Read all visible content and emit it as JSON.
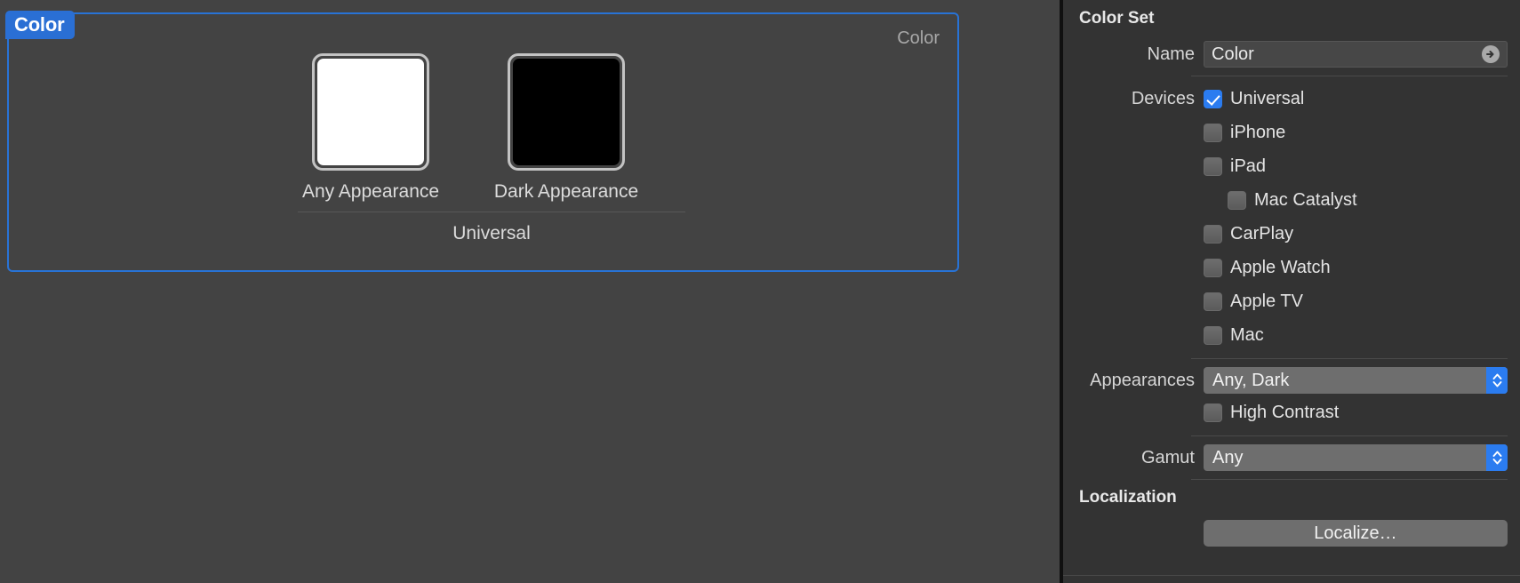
{
  "canvas": {
    "selection_tab_label": "Color",
    "corner_label": "Color",
    "group_label": "Universal",
    "swatches": [
      {
        "label": "Any Appearance",
        "color": "#ffffff"
      },
      {
        "label": "Dark Appearance",
        "color": "#000000"
      }
    ]
  },
  "inspector": {
    "color_set": {
      "title": "Color Set",
      "name_label": "Name",
      "name_value": "Color",
      "name_arrow_icon": "circle-arrow-right-icon",
      "devices_label": "Devices",
      "devices": [
        {
          "label": "Universal",
          "checked": true,
          "indent": 0
        },
        {
          "label": "iPhone",
          "checked": false,
          "indent": 0
        },
        {
          "label": "iPad",
          "checked": false,
          "indent": 0
        },
        {
          "label": "Mac Catalyst",
          "checked": false,
          "indent": 1
        },
        {
          "label": "CarPlay",
          "checked": false,
          "indent": 0
        },
        {
          "label": "Apple Watch",
          "checked": false,
          "indent": 0
        },
        {
          "label": "Apple TV",
          "checked": false,
          "indent": 0
        },
        {
          "label": "Mac",
          "checked": false,
          "indent": 0
        }
      ],
      "appearances_label": "Appearances",
      "appearances_value": "Any, Dark",
      "high_contrast_label": "High Contrast",
      "high_contrast_checked": false,
      "gamut_label": "Gamut",
      "gamut_value": "Any"
    },
    "localization": {
      "title": "Localization",
      "localize_button": "Localize…"
    }
  },
  "colors": {
    "accent_blue": "#2b7cf0",
    "selection_border": "#2873d6",
    "canvas_bg": "#434343",
    "inspector_bg": "#333333"
  }
}
